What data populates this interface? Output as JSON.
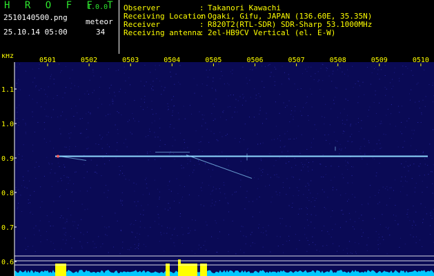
{
  "app": {
    "name": "H R O F F T",
    "version": "1.0.0"
  },
  "file_name": "2510140500.png",
  "meteor_label": "meteor",
  "date_time": "25.10.14 05:00",
  "meteor_count": "34",
  "info": [
    {
      "label": "Observer",
      "value": "Takanori Kawachi"
    },
    {
      "label": "Receiving Location",
      "value": "Ogaki, Gifu, JAPAN (136.60E, 35.35N)"
    },
    {
      "label": "Receiver",
      "value": "R820T2(RTL-SDR) SDR-Sharp 53.1000MHz"
    },
    {
      "label": "Receiving antenna",
      "value": "2el-HB9CV Vertical (el. E-W)"
    }
  ],
  "spectrogram": {
    "y_unit": "kHz",
    "y_ticks": [
      "1.1",
      "1.0",
      "0.9",
      "0.8",
      "0.7",
      "0.6"
    ],
    "y_tick_values": [
      1.1,
      1.0,
      0.9,
      0.8,
      0.7,
      0.6
    ],
    "x_ticks": [
      "0501",
      "0502",
      "0503",
      "0504",
      "0505",
      "0506",
      "0507",
      "0508",
      "0509",
      "0510"
    ],
    "carrier_khz": 0.905,
    "colors": {
      "background": "#0a0a55",
      "noise": "#2a2aa8",
      "carrier": "#8fd8ff",
      "labels": "#ffff00",
      "lines": "#ffffff",
      "power_fill": "#00c8ff",
      "power_peak": "#ffff00"
    }
  }
}
